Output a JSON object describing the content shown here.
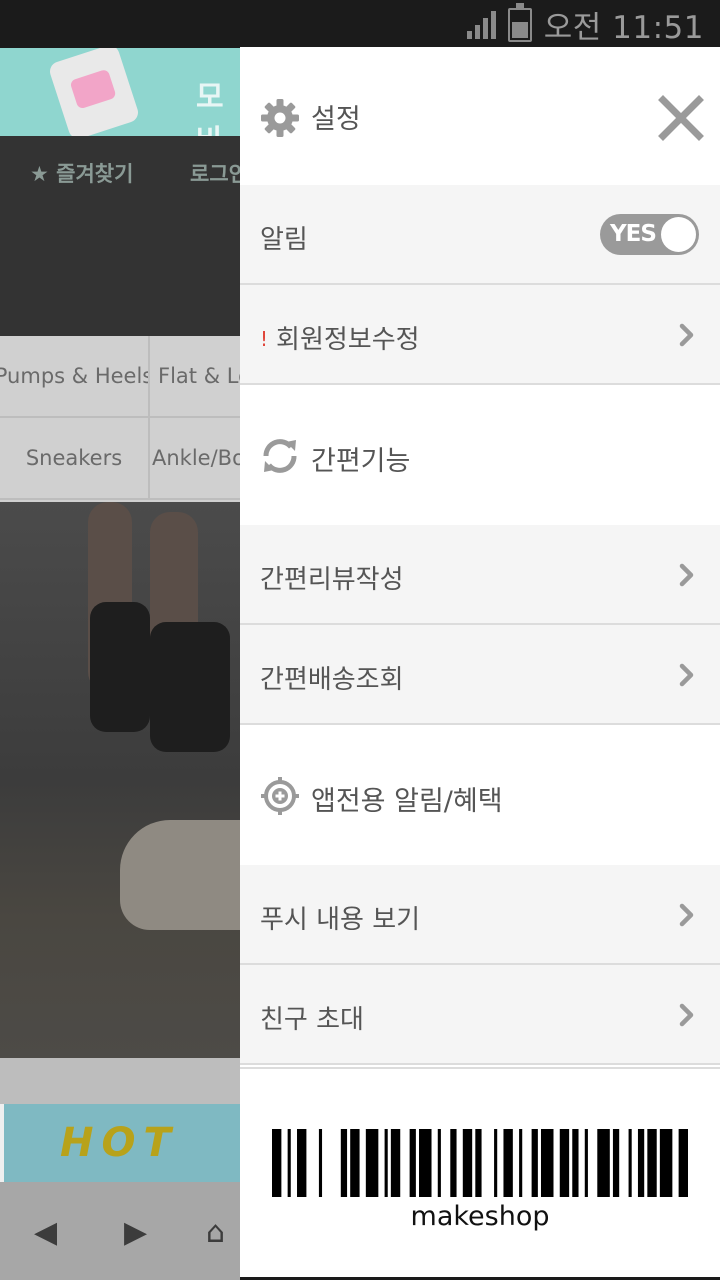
{
  "status_bar": {
    "time": "오전 11:51",
    "signal_icon": "signal-icon",
    "battery_icon": "battery-icon"
  },
  "background_page": {
    "banner_text": "모바",
    "nav_items": [
      "★ 즐겨찾기",
      "로그인"
    ],
    "categories": [
      "Pumps & Heels",
      "Flat & Loafers",
      "Sneakers",
      "Ankle/Boots"
    ],
    "promo_text": "HOT",
    "toolbar_icons": [
      "back-icon",
      "forward-icon",
      "home-icon"
    ]
  },
  "drawer": {
    "header": {
      "title": "설정",
      "settings_icon": "gear-icon",
      "close_icon": "close-icon"
    },
    "notification": {
      "label": "알림",
      "toggle_value": "YES"
    },
    "member_edit": {
      "alert_mark": "!",
      "label": "회원정보수정"
    },
    "quick_section": {
      "icon": "refresh-icon",
      "title": "간편기능"
    },
    "quick_items": [
      {
        "label": "간편리뷰작성"
      },
      {
        "label": "간편배송조회"
      }
    ],
    "benefit_section": {
      "icon": "target-plus-icon",
      "title": "앱전용 알림/혜택"
    },
    "benefit_items": [
      {
        "label": "푸시 내용 보기"
      },
      {
        "label": "친구 초대"
      }
    ],
    "barcode": {
      "text": "makeshop"
    }
  },
  "colors": {
    "drawer_background": "#ffffff",
    "row_background": "#f5f5f5",
    "text": "#555555",
    "icon_gray": "#9a9a9a",
    "alert": "#e0453a",
    "status_bar": "#1b1b1b"
  }
}
